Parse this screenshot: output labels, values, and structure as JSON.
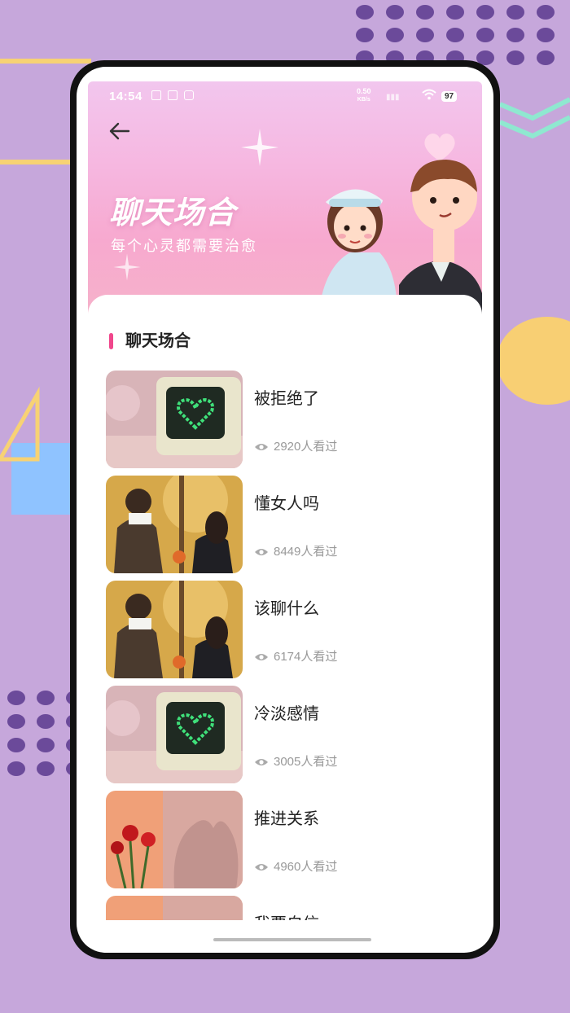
{
  "status_bar": {
    "time": "14:54",
    "speed_value": "0.50",
    "speed_unit": "KB/s",
    "battery": "97"
  },
  "hero": {
    "title": "聊天场合",
    "subtitle": "每个心灵都需要治愈"
  },
  "section": {
    "title": "聊天场合"
  },
  "items": [
    {
      "title": "被拒绝了",
      "views": "2920人看过",
      "thumb": "retro-computer-heart"
    },
    {
      "title": "懂女人吗",
      "views": "8449人看过",
      "thumb": "couple-autumn"
    },
    {
      "title": "该聊什么",
      "views": "6174人看过",
      "thumb": "couple-autumn"
    },
    {
      "title": "冷淡感情",
      "views": "3005人看过",
      "thumb": "retro-computer-heart"
    },
    {
      "title": "推进关系",
      "views": "4960人看过",
      "thumb": "roses-shadow-kiss"
    },
    {
      "title": "我要自信",
      "views": "",
      "thumb": "roses-shadow-kiss"
    }
  ],
  "colors": {
    "background": "#c6a7db",
    "accent": "#f0478c",
    "hero_pink": "#f7a9cf"
  }
}
